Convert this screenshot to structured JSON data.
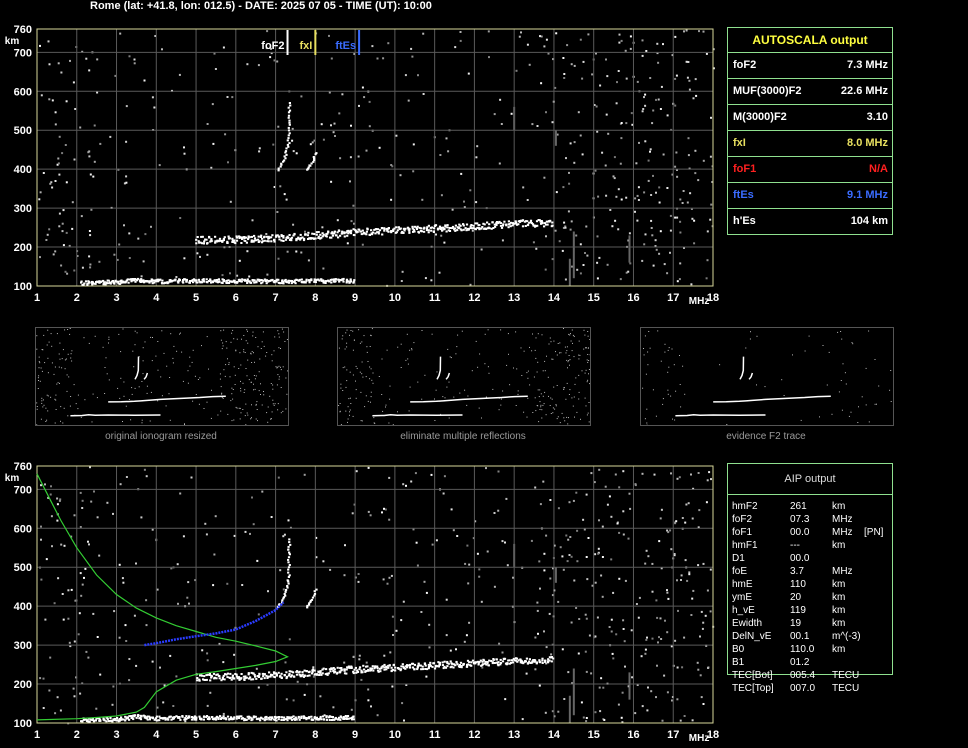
{
  "header": {
    "title": "Rome (lat: +41.8, lon: 012.5) - DATE: 2025 07 05 - TIME (UT): 10:00"
  },
  "colors": {
    "grid": "#5a5a5a",
    "frame": "#d8d89a",
    "trace": "#ffffff",
    "fxI": "#e8e060",
    "ftEs": "#3a6cff",
    "foF1": "#ff2020",
    "profile": "#33cc33",
    "profile_blue": "#2a3cff"
  },
  "autoscala": {
    "title": "AUTOSCALA output",
    "rows": [
      {
        "label": "foF2",
        "value": "7.3 MHz",
        "color": "#ffffff"
      },
      {
        "label": "MUF(3000)F2",
        "value": "22.6 MHz",
        "color": "#ffffff"
      },
      {
        "label": "M(3000)F2",
        "value": "3.10",
        "color": "#ffffff"
      },
      {
        "label": "fxI",
        "value": "8.0 MHz",
        "color": "#e8e060"
      },
      {
        "label": "foF1",
        "value": "N/A",
        "color": "#ff2020"
      },
      {
        "label": "ftEs",
        "value": "9.1 MHz",
        "color": "#3a6cff"
      },
      {
        "label": "h'Es",
        "value": "104    km",
        "color": "#ffffff"
      }
    ]
  },
  "thumbnails": [
    {
      "caption": "original ionogram resized"
    },
    {
      "caption": "eliminate multiple reflections"
    },
    {
      "caption": "evidence F2 trace"
    }
  ],
  "aip": {
    "title": "AIP output",
    "rows": [
      [
        "hmF2",
        "261",
        "km",
        ""
      ],
      [
        "foF2",
        "07.3",
        "MHz",
        ""
      ],
      [
        "foF1",
        "00.0",
        "MHz",
        "[PN]"
      ],
      [
        "hmF1",
        "---",
        "km",
        ""
      ],
      [
        "D1",
        "00.0",
        "",
        ""
      ],
      [
        "foE",
        "3.7",
        "MHz",
        ""
      ],
      [
        "hmE",
        "110",
        "km",
        ""
      ],
      [
        "ymE",
        "20",
        "km",
        ""
      ],
      [
        "h_vE",
        "119",
        "km",
        ""
      ],
      [
        "Ewidth",
        "19",
        "km",
        ""
      ],
      [
        "DelN_vE",
        "00.1",
        "m^(-3)",
        ""
      ],
      [
        "B0",
        "110.0",
        "km",
        ""
      ],
      [
        "B1",
        "01.2",
        "",
        ""
      ],
      [
        "TEC[Bot]",
        "005.4",
        "TECU",
        ""
      ],
      [
        "TEC[Top]",
        "007.0",
        "TECU",
        ""
      ]
    ]
  },
  "chart_data": [
    {
      "type": "scatter",
      "name": "ionogram-top",
      "title": "",
      "xlabel": "MHz",
      "ylabel": "km",
      "xlim": [
        1,
        18
      ],
      "ylim": [
        100,
        760
      ],
      "x_ticks": [
        "1",
        "2",
        "3",
        "4",
        "5",
        "6",
        "7",
        "8",
        "9",
        "10",
        "11",
        "12",
        "13",
        "14",
        "15",
        "16",
        "17",
        "18"
      ],
      "y_ticks": [
        "100",
        "200",
        "300",
        "400",
        "500",
        "600",
        "700",
        "760"
      ],
      "markers": [
        {
          "label": "foF2",
          "freq": 7.3,
          "color": "#ffffff"
        },
        {
          "label": "fxI",
          "freq": 8.0,
          "color": "#e8e060"
        },
        {
          "label": "ftEs",
          "freq": 9.1,
          "color": "#3a6cff"
        }
      ],
      "traces": {
        "es_layer": [
          [
            2.1,
            110
          ],
          [
            3,
            112
          ],
          [
            3.5,
            118
          ],
          [
            4,
            114
          ],
          [
            5,
            116
          ],
          [
            6,
            115
          ],
          [
            7,
            114
          ],
          [
            8,
            115
          ],
          [
            9,
            116
          ]
        ],
        "f_layer": [
          [
            5,
            220
          ],
          [
            6,
            221
          ],
          [
            7,
            225
          ],
          [
            7.5,
            228
          ],
          [
            8,
            232
          ],
          [
            9,
            240
          ],
          [
            10,
            245
          ],
          [
            11,
            250
          ],
          [
            12,
            255
          ],
          [
            13,
            262
          ],
          [
            14,
            265
          ]
        ],
        "f2_cusp_o": [
          [
            7.05,
            400
          ],
          [
            7.2,
            430
          ],
          [
            7.3,
            470
          ],
          [
            7.32,
            580
          ]
        ],
        "f2_cusp_x": [
          [
            7.75,
            400
          ],
          [
            7.9,
            420
          ],
          [
            8.0,
            450
          ]
        ]
      }
    },
    {
      "type": "line",
      "name": "ionogram-bottom",
      "title": "",
      "xlabel": "MHz",
      "ylabel": "km",
      "xlim": [
        1,
        18
      ],
      "ylim": [
        100,
        760
      ],
      "x_ticks": [
        "1",
        "2",
        "3",
        "4",
        "5",
        "6",
        "7",
        "8",
        "9",
        "10",
        "11",
        "12",
        "13",
        "14",
        "15",
        "16",
        "17",
        "18"
      ],
      "y_ticks": [
        "100",
        "200",
        "300",
        "400",
        "500",
        "600",
        "700",
        "760"
      ],
      "series": [
        {
          "values": [
            [
              1.0,
              740
            ],
            [
              1.3,
              680
            ],
            [
              1.6,
              620
            ],
            [
              2.0,
              550
            ],
            [
              2.5,
              480
            ],
            [
              3.0,
              430
            ],
            [
              3.5,
              395
            ],
            [
              4.0,
              370
            ],
            [
              4.5,
              350
            ],
            [
              5.0,
              335
            ],
            [
              5.5,
              320
            ],
            [
              6.0,
              310
            ],
            [
              6.5,
              298
            ],
            [
              7.0,
              285
            ],
            [
              7.3,
              270
            ],
            [
              7.0,
              258
            ],
            [
              6.5,
              248
            ],
            [
              6.0,
              240
            ],
            [
              5.5,
              232
            ],
            [
              5.0,
              225
            ],
            [
              4.5,
              210
            ],
            [
              4.0,
              180
            ],
            [
              3.7,
              140
            ],
            [
              3.5,
              128
            ],
            [
              3.0,
              118
            ],
            [
              2.5,
              114
            ],
            [
              2.0,
              111
            ],
            [
              1.0,
              108
            ]
          ]
        },
        {
          "values": [
            [
              3.7,
              300
            ],
            [
              4.0,
              305
            ],
            [
              4.5,
              315
            ],
            [
              5.0,
              323
            ],
            [
              5.5,
              330
            ],
            [
              6.0,
              340
            ],
            [
              6.5,
              362
            ],
            [
              7.0,
              390
            ],
            [
              7.2,
              410
            ]
          ]
        }
      ],
      "traces": {
        "es_layer": [
          [
            2.1,
            110
          ],
          [
            3,
            112
          ],
          [
            3.5,
            118
          ],
          [
            4,
            114
          ],
          [
            5,
            116
          ],
          [
            6,
            115
          ],
          [
            7,
            114
          ],
          [
            8,
            115
          ],
          [
            9,
            116
          ]
        ],
        "f_layer": [
          [
            5,
            220
          ],
          [
            6,
            221
          ],
          [
            7,
            225
          ],
          [
            7.5,
            228
          ],
          [
            8,
            232
          ],
          [
            9,
            240
          ],
          [
            10,
            245
          ],
          [
            11,
            250
          ],
          [
            12,
            255
          ],
          [
            13,
            262
          ],
          [
            14,
            265
          ]
        ],
        "f2_cusp_o": [
          [
            7.05,
            400
          ],
          [
            7.2,
            430
          ],
          [
            7.3,
            470
          ],
          [
            7.32,
            580
          ]
        ],
        "f2_cusp_x": [
          [
            7.75,
            400
          ],
          [
            7.9,
            420
          ],
          [
            8.0,
            450
          ]
        ]
      }
    }
  ]
}
